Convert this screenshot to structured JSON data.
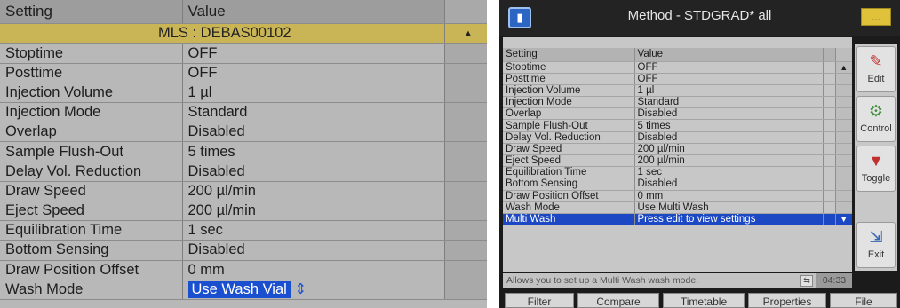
{
  "left": {
    "header": {
      "setting": "Setting",
      "value": "Value"
    },
    "section_title": "MLS : DEBAS00102",
    "rows": [
      {
        "setting": "Stoptime",
        "value": "OFF"
      },
      {
        "setting": "Posttime",
        "value": "OFF"
      },
      {
        "setting": "Injection Volume",
        "value": "1 µl"
      },
      {
        "setting": "Injection Mode",
        "value": "Standard"
      },
      {
        "setting": "Overlap",
        "value": "Disabled"
      },
      {
        "setting": "Sample Flush-Out",
        "value": "5 times"
      },
      {
        "setting": "Delay Vol. Reduction",
        "value": "Disabled"
      },
      {
        "setting": "Draw Speed",
        "value": "200 µl/min"
      },
      {
        "setting": "Eject Speed",
        "value": "200 µl/min"
      },
      {
        "setting": "Equilibration Time",
        "value": "1 sec"
      },
      {
        "setting": "Bottom Sensing",
        "value": "Disabled"
      },
      {
        "setting": "Draw Position Offset",
        "value": "0 mm"
      },
      {
        "setting": "Wash Mode",
        "value": "Use Wash Vial"
      }
    ],
    "spinner_glyph": "⇕"
  },
  "right": {
    "title": "Method - STDGRAD* all",
    "corner_label": "...",
    "header": {
      "setting": "Setting",
      "value": "Value"
    },
    "rows": [
      {
        "setting": "Stoptime",
        "value": "OFF"
      },
      {
        "setting": "Posttime",
        "value": "OFF"
      },
      {
        "setting": "Injection Volume",
        "value": "1 µl"
      },
      {
        "setting": "Injection Mode",
        "value": "Standard"
      },
      {
        "setting": "Overlap",
        "value": "Disabled"
      },
      {
        "setting": "Sample Flush-Out",
        "value": "5 times"
      },
      {
        "setting": "Delay Vol. Reduction",
        "value": "Disabled"
      },
      {
        "setting": "Draw Speed",
        "value": "200 µl/min"
      },
      {
        "setting": "Eject Speed",
        "value": "200 µl/min"
      },
      {
        "setting": "Equilibration Time",
        "value": "1 sec"
      },
      {
        "setting": "Bottom Sensing",
        "value": "Disabled"
      },
      {
        "setting": "Draw Position Offset",
        "value": "0 mm"
      },
      {
        "setting": "Wash Mode",
        "value": "Use Multi Wash"
      },
      {
        "setting": "Multi Wash",
        "value": "Press edit to view settings"
      }
    ],
    "status_text": "Allows you to set up a Multi Wash wash mode.",
    "time": "04:33",
    "side_buttons": [
      {
        "label": "Edit",
        "icon": "edit-icon"
      },
      {
        "label": "Control",
        "icon": "control-icon"
      },
      {
        "label": "Toggle",
        "icon": "toggle-icon"
      },
      {
        "label": "Exit",
        "icon": "exit-icon"
      }
    ],
    "tabs": [
      "Filter",
      "Compare",
      "Timetable",
      "Properties",
      "File"
    ]
  }
}
